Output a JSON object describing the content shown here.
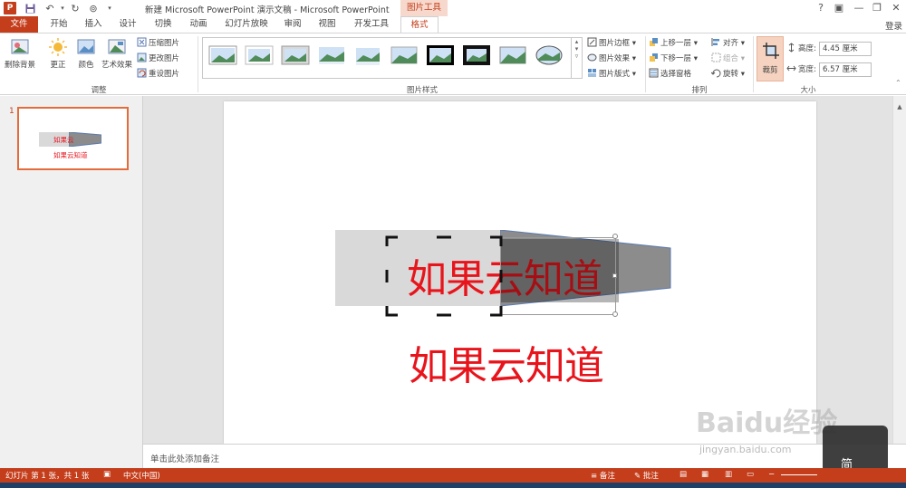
{
  "titlebar": {
    "app_icon": "P",
    "title": "新建 Microsoft PowerPoint 演示文稿 - Microsoft PowerPoint",
    "context_tab_title": "图片工具",
    "help": "?",
    "minimize": "—",
    "restore": "❐",
    "close": "✕",
    "ribbon_display": "▣"
  },
  "tabs": {
    "file": "文件",
    "home": "开始",
    "insert": "插入",
    "design": "设计",
    "transitions": "切换",
    "animations": "动画",
    "slideshow": "幻灯片放映",
    "review": "审阅",
    "view": "视图",
    "developer": "开发工具",
    "format": "格式",
    "login": "登录"
  },
  "ribbon": {
    "adjust": {
      "remove_bg": "删除背景",
      "corrections": "更正",
      "color": "颜色",
      "artistic": "艺术效果",
      "compress": "压缩图片",
      "change": "更改图片",
      "reset": "重设图片",
      "group_label": "调整"
    },
    "styles": {
      "group_label": "图片样式",
      "border": "图片边框",
      "effects": "图片效果",
      "layout": "图片版式"
    },
    "arrange": {
      "bring_forward": "上移一层",
      "send_backward": "下移一层",
      "selection_pane": "选择窗格",
      "align": "对齐",
      "group": "组合",
      "rotate": "旋转",
      "group_label": "排列"
    },
    "size": {
      "crop": "裁剪",
      "height_label": "高度:",
      "height_value": "4.45 厘米",
      "width_label": "宽度:",
      "width_value": "6.57 厘米",
      "group_label": "大小"
    }
  },
  "slides_pane": {
    "slide_number": "1",
    "thumb_text_top": "如果云",
    "thumb_text_bottom": "如果云知道"
  },
  "slide": {
    "picture_text": "如果云知道",
    "text_box": "如果云知道"
  },
  "notes": {
    "placeholder": "单击此处添加备注"
  },
  "statusbar": {
    "slide_info": "幻灯片 第 1 张，共 1 张",
    "language": "中文(中国)",
    "notes_btn": "备注",
    "comments_btn": "批注"
  },
  "watermark": {
    "brand": "Baidu经验",
    "url": "jingyan.baidu.com",
    "ime": "简"
  },
  "colors": {
    "accent": "#c43e1c",
    "text_red": "#e8141c"
  }
}
